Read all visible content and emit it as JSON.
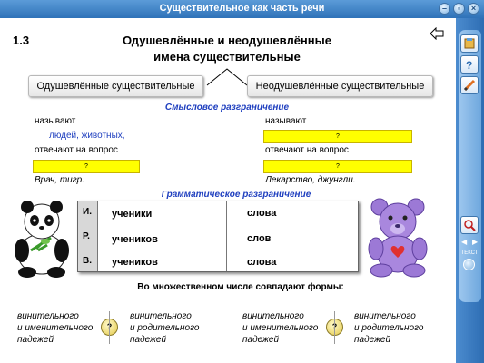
{
  "window": {
    "title": "Существительное как часть речи"
  },
  "header": {
    "number": "1.3",
    "title_line1": "Одушевлённые и неодушевлённые",
    "title_line2": "имена существительные"
  },
  "categories": {
    "animate": "Одушевлённые существительные",
    "inanimate": "Неодушевлённые существительные"
  },
  "semantic": {
    "title": "Смысловое разграничение",
    "left_names": "называют",
    "left_examples": "людей, животных,",
    "left_answers": "отвечают на вопрос",
    "left_blank": "?",
    "left_sample": "Врач, тигр.",
    "right_names": "называют",
    "right_blank1": "?",
    "right_answers": "отвечают на вопрос",
    "right_blank2": "?",
    "right_sample": "Лекарство, джунгли."
  },
  "grammatical": {
    "title": "Грамматическое разграничение",
    "rows": [
      {
        "case": "И.",
        "animate": "ученики",
        "inanimate": "слова"
      },
      {
        "case": "Р.",
        "animate": "учеников",
        "inanimate": "слов"
      },
      {
        "case": "В.",
        "animate": "учеников",
        "inanimate": "слова"
      }
    ]
  },
  "plural": {
    "title": "Во множественном числе совпадают формы:",
    "options": [
      {
        "l1": "винительного",
        "l2": "и именительного",
        "l3": "падежей"
      },
      {
        "l1": "винительного",
        "l2": "и родительного",
        "l3": "падежей"
      },
      {
        "l1": "винительного",
        "l2": "и именительного",
        "l3": "падежей"
      },
      {
        "l1": "винительного",
        "l2": "и родительного",
        "l3": "падежей"
      }
    ],
    "question_mark": "?"
  },
  "sidebar": {
    "text_label": "ТЕКСТ"
  },
  "colors": {
    "accent_blue": "#1f3fbf",
    "highlight": "#ffff00",
    "titlebar": "#3a7fc4"
  },
  "icons": [
    "minimize-icon",
    "restore-icon",
    "close-icon",
    "back-arrow-icon",
    "book-icon",
    "help-icon",
    "pencil-icon",
    "zoom-icon",
    "prev-icon",
    "next-icon"
  ]
}
